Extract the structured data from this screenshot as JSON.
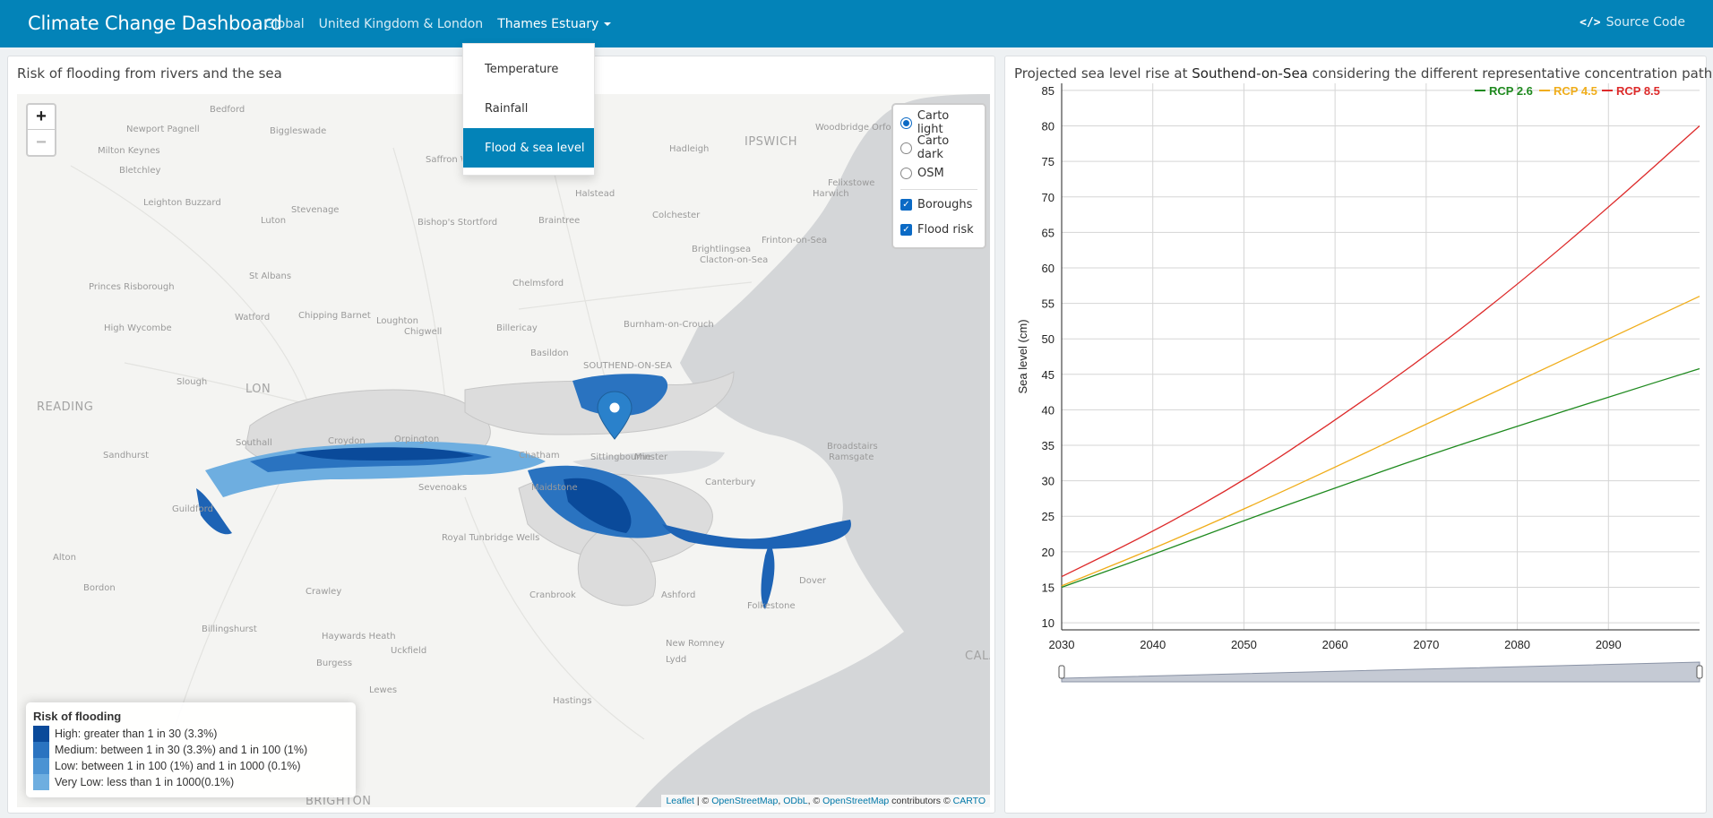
{
  "navbar": {
    "brand": "Climate Change Dashboard",
    "links": [
      {
        "label": "Global"
      },
      {
        "label": "United Kingdom & London"
      },
      {
        "label": "Thames Estuary"
      }
    ],
    "source_code": "Source Code",
    "source_icon": "code-icon",
    "background": "#0383b8"
  },
  "dropdown": {
    "items": [
      "Temperature",
      "Rainfall",
      "Flood & sea level"
    ],
    "selected": "Flood & sea level"
  },
  "left_panel": {
    "title": "Risk of flooding from rivers and the sea",
    "zoom": {
      "in": "+",
      "out": "−"
    },
    "layers": {
      "base": [
        {
          "label": "Carto light",
          "checked": true
        },
        {
          "label": "Carto dark",
          "checked": false
        },
        {
          "label": "OSM",
          "checked": false
        }
      ],
      "overlays": [
        {
          "label": "Boroughs",
          "checked": true
        },
        {
          "label": "Flood risk",
          "checked": true
        }
      ]
    },
    "legend": {
      "title": "Risk of flooding",
      "items": [
        {
          "label": "High: greater than 1 in 30 (3.3%)",
          "color": "#0a4a9a"
        },
        {
          "label": "Medium: between 1 in 30 (3.3%) and 1 in 100 (1%)",
          "color": "#2a73c0"
        },
        {
          "label": "Low: between 1 in 100 (1%) and 1 in 1000 (0.1%)",
          "color": "#4b93d3"
        },
        {
          "label": "Very Low: less than 1 in 1000(0.1%)",
          "color": "#6eaee0"
        }
      ]
    },
    "attribution": {
      "leaflet": "Leaflet",
      "sep1": " | © ",
      "osm": "OpenStreetMap",
      "sep2": ", ",
      "odbl": "ODbL",
      "sep3": ", © ",
      "osm2": "OpenStreetMap",
      "contrib": " contributors © ",
      "carto": "CARTO"
    },
    "places": [
      "Bedford",
      "Newport Pagnell",
      "Biggleswade",
      "Milton Keynes",
      "Bletchley",
      "Leighton Buzzard",
      "Stevenage",
      "Luton",
      "Saffron W",
      "Bishop's Stortford",
      "Braintree",
      "Halstead",
      "Hadleigh",
      "IPSWICH",
      "Woodbridge",
      "Orfor",
      "Felixstowe",
      "Harwich",
      "Colchester",
      "Frinton-on-Sea",
      "Brightlingsea",
      "Clacton-on-Sea",
      "Chelmsford",
      "St Albans",
      "Princes Risborough",
      "Watford",
      "Chipping Barnet",
      "Loughton",
      "Chigwell",
      "Billericay",
      "High Wycombe",
      "Slough",
      "READING",
      "Basildon",
      "Burnham-on-Crouch",
      "SOUTHEND-ON-SEA",
      "Croydon",
      "Orpington",
      "Sandhurst",
      "Sevenoaks",
      "Maidstone",
      "Sittingbourne",
      "Canterbury",
      "Broadstairs",
      "Ramsgate",
      "Guildford",
      "Alton",
      "Bordon",
      "Royal Tunbridge Wells",
      "Crawley",
      "Cranbrook",
      "Ashford",
      "Folkestone",
      "Dover",
      "Billingshurst",
      "Haywards Heath",
      "Uckfield",
      "Burgess",
      "New Romney",
      "Lydd",
      "Lewes",
      "Hastings",
      "BRIGHTON",
      "CALA",
      "LON",
      "Chatham",
      "Minster",
      "Southall"
    ]
  },
  "right_panel": {
    "title_pre": "Projected sea level rise at ",
    "title_place": "Southend-on-Sea",
    "title_post": " considering the different representative concentration pathways (RCP)"
  },
  "chart_data": {
    "type": "line",
    "title": "Projected sea level rise at Southend-on-Sea considering the different representative concentration pathways (RCP)",
    "xlabel": "",
    "ylabel": "Sea level (cm)",
    "xlim": [
      2030,
      2100
    ],
    "ylim": [
      9,
      86
    ],
    "xticks": [
      2030,
      2040,
      2050,
      2060,
      2070,
      2080,
      2090
    ],
    "yticks": [
      10,
      15,
      20,
      25,
      30,
      35,
      40,
      45,
      50,
      55,
      60,
      65,
      70,
      75,
      80,
      85
    ],
    "grid": true,
    "legend_position": "top-right",
    "x": [
      2030,
      2040,
      2050,
      2060,
      2070,
      2080,
      2090,
      2100
    ],
    "series": [
      {
        "name": "RCP 2.6",
        "color": "#1f8a1f",
        "values": [
          15.0,
          19.6,
          24.4,
          29.0,
          33.5,
          37.7,
          41.8,
          45.8
        ]
      },
      {
        "name": "RCP 4.5",
        "color": "#f0ad1a",
        "values": [
          15.2,
          20.4,
          26.0,
          31.9,
          38.0,
          44.0,
          50.0,
          56.0
        ]
      },
      {
        "name": "RCP 8.5",
        "color": "#dd2a2a",
        "values": [
          16.5,
          22.8,
          30.0,
          38.5,
          47.6,
          57.6,
          68.5,
          80.0
        ]
      }
    ]
  }
}
